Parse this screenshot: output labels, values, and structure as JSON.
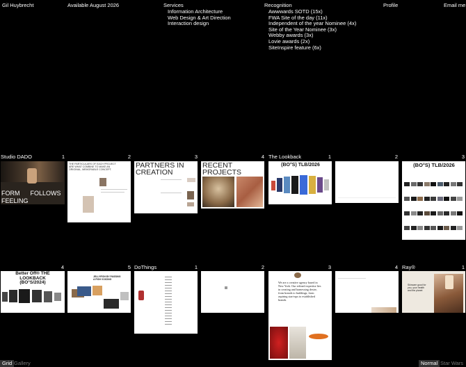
{
  "header": {
    "name": "Gil Huybrecht",
    "availability": "Available August 2026",
    "services_label": "Services",
    "services": [
      "Information Architecture",
      "Web Design & Art Direction",
      "Interaction design"
    ],
    "recognition_label": "Recognition",
    "recognition": [
      "Awwwards SOTD (15x)",
      "FWA Site of the day (11x)",
      "Independent of the year Nominee (4x)",
      "Site of the Year Nominee (3x)",
      "Webby awards (3x)",
      "Lovie awards (2x)",
      "SiteInspire feature (6x)"
    ],
    "profile_label": "Profile",
    "email_label": "Email me"
  },
  "projects": [
    {
      "title": "Studio DADO",
      "indices": [
        "1",
        "2",
        "3",
        "4"
      ],
      "thumb_texts": {
        "t1": "FORM      FOLLOWS\nFEELING",
        "t2": "THE PARTICULARS OF EACH PROJECT ARE WHAT COMBINE TO MAKE AN ORIGINAL, MEMORABLE CONCEPT.",
        "t3": "PARTNERS IN CREATION",
        "t4": "RECENT PROJECTS"
      }
    },
    {
      "title": "The Lookback",
      "indices": [
        "1",
        "2",
        "3"
      ],
      "thumb_texts": {
        "t1": "(BO°S) TLB/2026",
        "t3": "(BO°S) TLB/2026"
      }
    },
    {
      "title": "",
      "indices": [
        "4",
        "5"
      ],
      "thumb_texts": {
        "t4": "Better Off® THE LOOKBACK (BO°S/2024)",
        "t5": "JELLYFISH BY PASSING A FISH VOICING"
      }
    },
    {
      "title": "DoThings",
      "indices": [
        "1",
        "2",
        "3",
        "4"
      ],
      "thumb_texts": {
        "t3": "We are a creative agency based in New York. Our refined expertise lies in creating and harnessing desire, from brands to buildings, from aspiring start-ups to established brands."
      }
    },
    {
      "title": "Ray®",
      "indices": [
        "1"
      ],
      "thumb_texts": {
        "t1": "Skincare good for you, your health and the planet"
      }
    }
  ],
  "footer": {
    "view_grid": "Grid",
    "view_gallery": "Gallery",
    "mode_normal": "Normal",
    "mode_star_wars": "Star Wars"
  }
}
